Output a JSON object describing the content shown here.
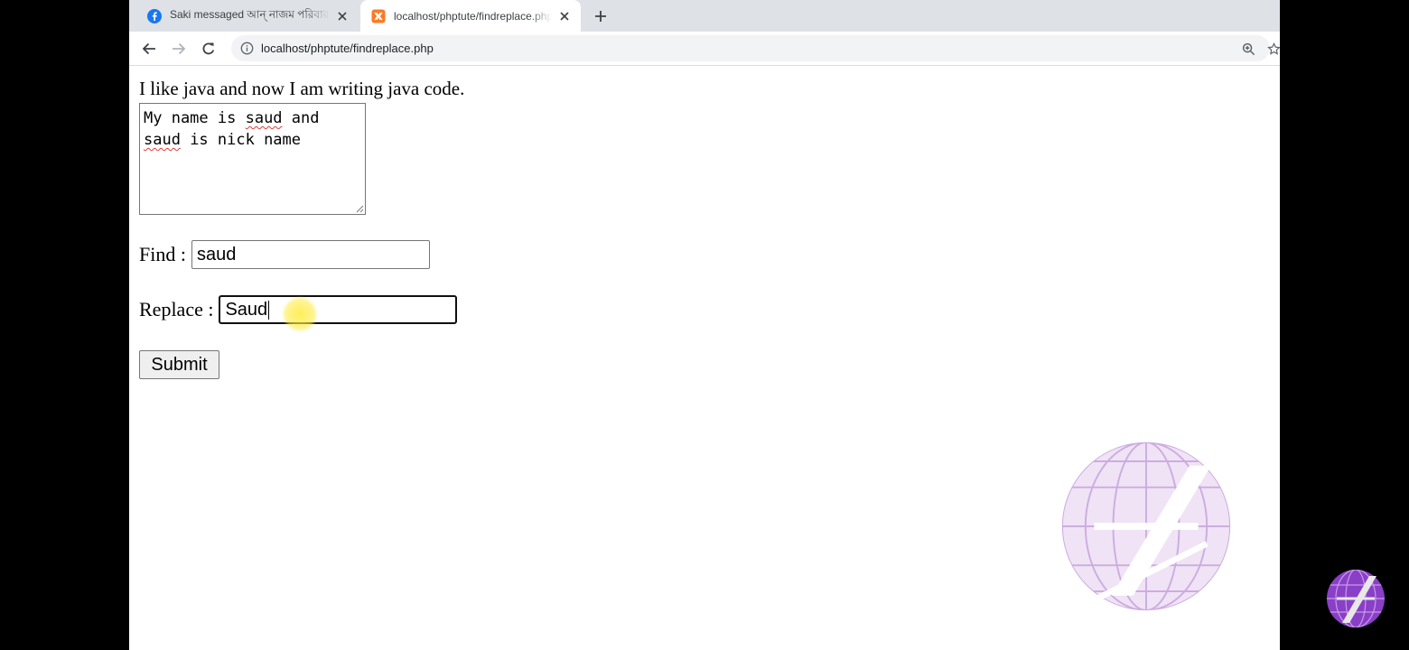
{
  "browser": {
    "tabs": [
      {
        "title": "Saki messaged আন্ নাজম পরিবার",
        "favicon": "facebook-icon",
        "active": false
      },
      {
        "title": "localhost/phptute/findreplace.php",
        "favicon": "xampp-icon",
        "active": true
      }
    ],
    "url": "localhost/phptute/findreplace.php"
  },
  "page": {
    "heading": "I like java and now I am writing java code.",
    "textarea": {
      "line1_a": "My name is ",
      "line1_word": "saud",
      "line1_b": " and",
      "line2_word": "saud",
      "line2_b": " is nick name"
    },
    "find": {
      "label": "Find :",
      "value": "saud"
    },
    "replace": {
      "label": "Replace :",
      "value": "Saud"
    },
    "submit_label": "Submit"
  },
  "colors": {
    "accent_facebook": "#1877f2",
    "xampp_orange": "#fb7a24",
    "watermark_purple": "#b58fd4"
  }
}
